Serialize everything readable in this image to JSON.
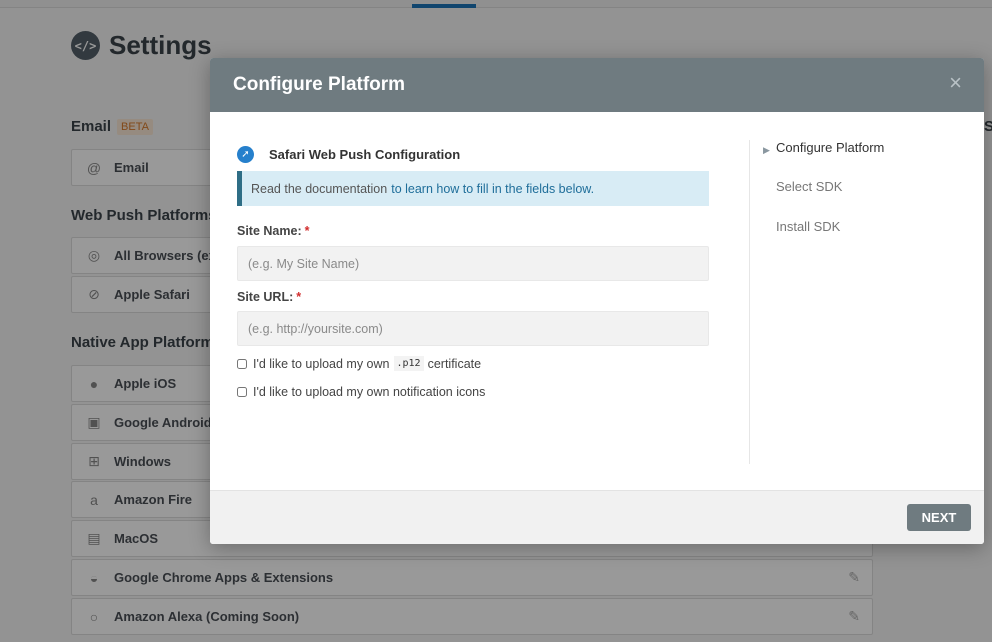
{
  "page": {
    "title": "Settings",
    "title_icon": "code-icon",
    "right_column_fragment": "S"
  },
  "sections": {
    "email": {
      "title": "Email",
      "badge": "BETA"
    },
    "web_push": {
      "title": "Web Push Platforms"
    },
    "native_app": {
      "title": "Native App Platforms"
    }
  },
  "platform_rows": [
    {
      "label": "Email",
      "icon": "at-sign-icon"
    },
    {
      "label": "All Browsers (excluding Safari)",
      "icon": "chrome-icon"
    },
    {
      "label": "Apple Safari",
      "icon": "safari-compass-icon"
    },
    {
      "label": "Apple iOS",
      "icon": "apple-icon"
    },
    {
      "label": "Google Android",
      "icon": "android-icon"
    },
    {
      "label": "Windows",
      "icon": "windows-icon"
    },
    {
      "label": "Amazon Fire",
      "icon": "amazon-icon"
    },
    {
      "label": "MacOS",
      "icon": "finder-icon"
    },
    {
      "label": "Google Chrome Apps & Extensions",
      "icon": "chrome-app-icon"
    },
    {
      "label": "Amazon Alexa (Coming Soon)",
      "icon": "alexa-ring-icon"
    }
  ],
  "modal": {
    "title": "Configure Platform",
    "close_label": "×",
    "platform_title": "Safari Web Push Configuration",
    "info_text": "Read the documentation",
    "info_link": "to learn how to fill in the fields below.",
    "fields": {
      "site_name": {
        "label": "Site Name:",
        "required_mark": "*",
        "placeholder": "(e.g. My Site Name)",
        "value": ""
      },
      "site_url": {
        "label": "Site URL:",
        "required_mark": "*",
        "placeholder": "(e.g. http://yoursite.com)",
        "value": ""
      }
    },
    "checkboxes": {
      "upload_cert": {
        "prefix": "I'd like to upload my own",
        "code": ".p12",
        "suffix": "certificate",
        "checked": false
      },
      "upload_icons": {
        "label": "I'd like to upload my own notification icons",
        "checked": false
      }
    },
    "steps": [
      "Configure Platform",
      "Select SDK",
      "Install SDK"
    ],
    "active_step": 0,
    "next_label": "NEXT"
  },
  "colors": {
    "header_bg": "#6f7b80",
    "info_bg": "#d8ecf5",
    "info_border": "#2f6e86",
    "link": "#1f6e9a",
    "required": "#d12c2c",
    "accent": "#1b74b8"
  }
}
